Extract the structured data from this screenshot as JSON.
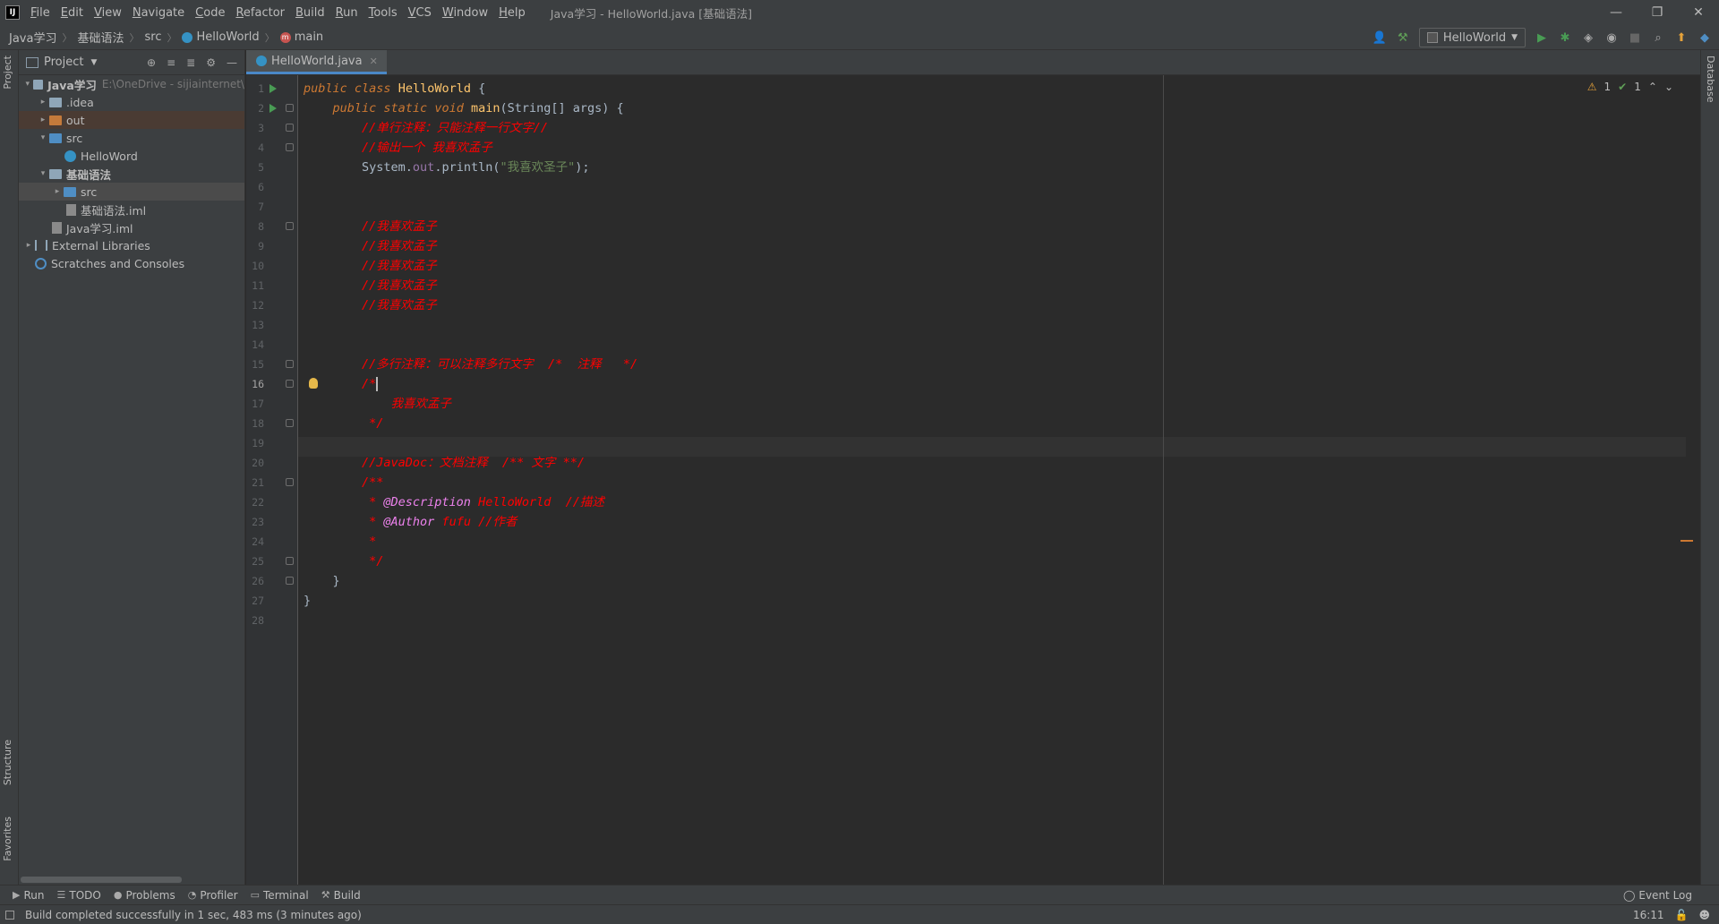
{
  "app": {
    "logo": "IJ",
    "menu": [
      "File",
      "Edit",
      "View",
      "Navigate",
      "Code",
      "Refactor",
      "Build",
      "Run",
      "Tools",
      "VCS",
      "Window",
      "Help"
    ],
    "window_title": "Java学习 - HelloWorld.java [基础语法]"
  },
  "breadcrumb": [
    "Java学习",
    "基础语法",
    "src",
    "HelloWorld",
    "main"
  ],
  "run_config": "HelloWorld",
  "project_panel": {
    "title": "Project",
    "tree": [
      {
        "label": "Java学习",
        "hint": "E:\\OneDrive - sijiainternet\\",
        "indent": 0,
        "arrow": "▾",
        "icon": "proj",
        "bold": true
      },
      {
        "label": ".idea",
        "indent": 1,
        "arrow": "▸",
        "icon": "folder"
      },
      {
        "label": "out",
        "indent": 1,
        "arrow": "▸",
        "icon": "orange"
      },
      {
        "label": "src",
        "indent": 1,
        "arrow": "▾",
        "icon": "blue"
      },
      {
        "label": "HelloWord",
        "indent": 2,
        "arrow": "",
        "icon": "class"
      },
      {
        "label": "基础语法",
        "indent": 1,
        "arrow": "▾",
        "icon": "folder",
        "bold": true
      },
      {
        "label": "src",
        "indent": 2,
        "arrow": "▸",
        "icon": "blue"
      },
      {
        "label": "基础语法.iml",
        "indent": 2,
        "arrow": "",
        "icon": "file"
      },
      {
        "label": "Java学习.iml",
        "indent": 1,
        "arrow": "",
        "icon": "file"
      },
      {
        "label": "External Libraries",
        "indent": 0,
        "arrow": "▸",
        "icon": "lib"
      },
      {
        "label": "Scratches and Consoles",
        "indent": 0,
        "arrow": "",
        "icon": "scratch"
      }
    ]
  },
  "editor": {
    "tab": "HelloWorld.java",
    "inspections": {
      "warnings": "1",
      "weak": "1"
    },
    "current_line": 16,
    "lines": [
      [
        {
          "t": "public ",
          "c": "kw"
        },
        {
          "t": "class ",
          "c": "kw"
        },
        {
          "t": "HelloWorld",
          "c": "cls"
        },
        {
          "t": " {",
          "c": "plain"
        }
      ],
      [
        {
          "t": "    public ",
          "c": "kw"
        },
        {
          "t": "static ",
          "c": "kw"
        },
        {
          "t": "void ",
          "c": "kw"
        },
        {
          "t": "main",
          "c": "cls"
        },
        {
          "t": "(String[] ",
          "c": "plain"
        },
        {
          "t": "args",
          "c": "param"
        },
        {
          "t": ") {",
          "c": "plain"
        }
      ],
      [
        {
          "t": "        //单行注释：只能注释一行文字//",
          "c": "cmt"
        }
      ],
      [
        {
          "t": "        //输出一个 我喜欢孟子",
          "c": "cmt"
        }
      ],
      [
        {
          "t": "        System.",
          "c": "plain"
        },
        {
          "t": "out",
          "c": "fld"
        },
        {
          "t": ".println(",
          "c": "plain"
        },
        {
          "t": "\"我喜欢圣子\"",
          "c": "str"
        },
        {
          "t": ");",
          "c": "plain"
        }
      ],
      [],
      [],
      [
        {
          "t": "        //我喜欢孟子",
          "c": "cmt"
        }
      ],
      [
        {
          "t": "        //我喜欢孟子",
          "c": "cmt"
        }
      ],
      [
        {
          "t": "        //我喜欢孟子",
          "c": "cmt"
        }
      ],
      [
        {
          "t": "        //我喜欢孟子",
          "c": "cmt"
        }
      ],
      [
        {
          "t": "        //我喜欢孟子",
          "c": "cmt"
        }
      ],
      [],
      [],
      [
        {
          "t": "        //多行注释：可以注释多行文字  /*  注释   */",
          "c": "cmt"
        }
      ],
      [
        {
          "t": "        /*",
          "c": "cmt"
        }
      ],
      [
        {
          "t": "            我喜欢孟子",
          "c": "cmt"
        }
      ],
      [
        {
          "t": "         */",
          "c": "cmt"
        }
      ],
      [],
      [
        {
          "t": "        //JavaDoc：文档注释  /** 文字 **/",
          "c": "cmt"
        }
      ],
      [
        {
          "t": "        /**",
          "c": "cmt"
        }
      ],
      [
        {
          "t": "         * ",
          "c": "cmt"
        },
        {
          "t": "@Description ",
          "c": "tag"
        },
        {
          "t": "HelloWorld  //描述",
          "c": "tagv"
        }
      ],
      [
        {
          "t": "         * ",
          "c": "cmt"
        },
        {
          "t": "@Author ",
          "c": "tag"
        },
        {
          "t": "fufu //作者",
          "c": "tagv"
        }
      ],
      [
        {
          "t": "         *",
          "c": "cmt"
        }
      ],
      [
        {
          "t": "         */",
          "c": "cmt"
        }
      ],
      [
        {
          "t": "    }",
          "c": "plain"
        }
      ],
      [
        {
          "t": "}",
          "c": "plain"
        }
      ],
      []
    ],
    "run_lines": [
      1,
      2
    ],
    "fold_lines": [
      2,
      3,
      4,
      8,
      15,
      16,
      18,
      21,
      25,
      26
    ],
    "bulb_line": 16
  },
  "bottom_tabs": [
    {
      "label": "Run",
      "icon": "▶"
    },
    {
      "label": "TODO",
      "icon": "☰"
    },
    {
      "label": "Problems",
      "icon": "●"
    },
    {
      "label": "Profiler",
      "icon": "◔"
    },
    {
      "label": "Terminal",
      "icon": "▭"
    },
    {
      "label": "Build",
      "icon": "⚒"
    }
  ],
  "event_log": "Event Log",
  "status": {
    "message": "Build completed successfully in 1 sec, 483 ms (3 minutes ago)",
    "time": "16:11"
  },
  "stripes": {
    "left_top": "Project",
    "left_structure": "Structure",
    "left_favorites": "Favorites",
    "right": "Database"
  }
}
